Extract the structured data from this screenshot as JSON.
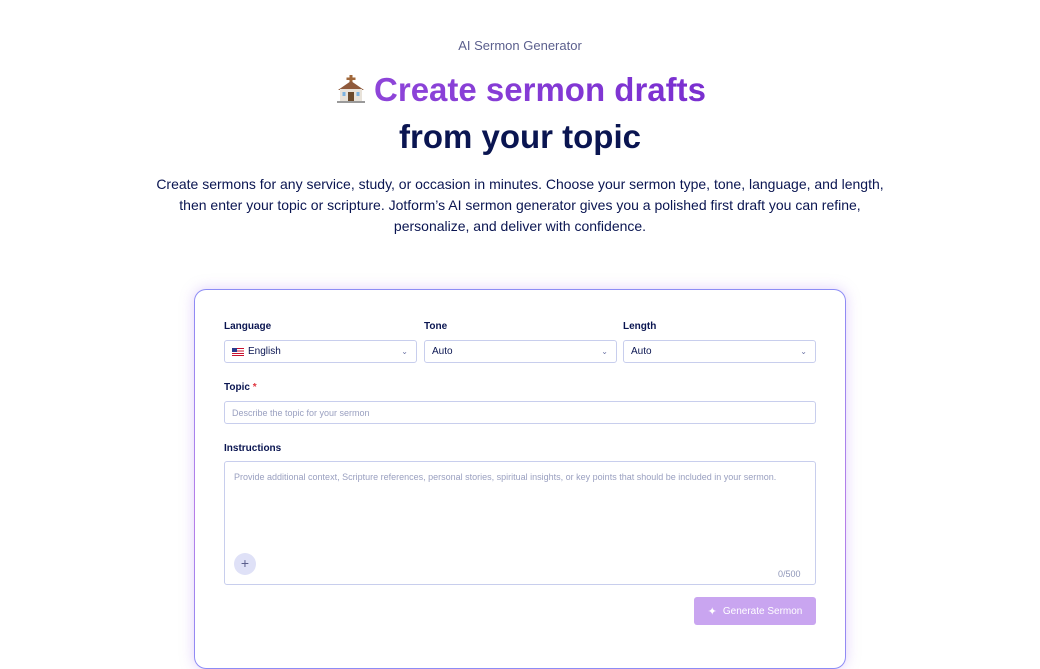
{
  "header": {
    "eyebrow": "AI Sermon Generator",
    "title_line1": "Create sermon drafts",
    "title_line2": "from your topic",
    "title_icon": "church-icon",
    "description": "Create sermons for any service, study, or occasion in minutes. Choose your sermon type, tone, language, and length, then enter your topic or scripture. Jotform’s AI sermon generator gives you a polished first draft you can refine, personalize, and deliver with confidence."
  },
  "form": {
    "language": {
      "label": "Language",
      "value": "English",
      "icon": "us-flag-icon"
    },
    "tone": {
      "label": "Tone",
      "value": "Auto"
    },
    "length": {
      "label": "Length",
      "value": "Auto"
    },
    "topic": {
      "label": "Topic",
      "required_mark": "*",
      "placeholder": "Describe the topic for your sermon"
    },
    "instructions": {
      "label": "Instructions",
      "placeholder": "Provide additional context, Scripture references, personal stories, spiritual insights, or key points that should be included in your sermon.",
      "counter": "0/500",
      "add_icon": "plus-icon"
    },
    "submit": {
      "label": "Generate Sermon",
      "icon": "sparkle-icon"
    }
  },
  "colors": {
    "accent_purple": "#8e45d9",
    "navy": "#0a1551",
    "button_disabled": "#c9a5f0",
    "border": "#c8ceed"
  }
}
